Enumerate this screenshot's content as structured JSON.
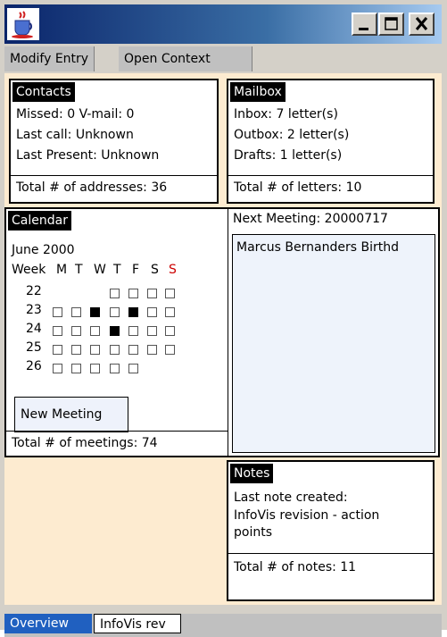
{
  "window": {
    "icon": "java-cup-icon",
    "controls": [
      "minimize",
      "maximize",
      "close"
    ]
  },
  "menu": {
    "items": [
      "Modify Entry",
      "Open Context"
    ]
  },
  "contacts": {
    "title": "Contacts",
    "missed": "Missed: 0 V-mail: 0",
    "last_call": "Last call: Unknown",
    "last_present": "Last Present: Unknown",
    "total": "Total # of addresses: 36"
  },
  "mailbox": {
    "title": "Mailbox",
    "inbox": "Inbox: 7 letter(s)",
    "outbox": "Outbox: 2 letter(s)",
    "drafts": "Drafts: 1 letter(s)",
    "total": "Total # of letters: 10"
  },
  "calendar": {
    "title": "Calendar",
    "month": "June 2000",
    "header": {
      "week": "Week",
      "days": [
        "M",
        "T",
        "W",
        "T",
        "F",
        "S",
        "S"
      ],
      "sunday_color": "#cc0000"
    },
    "weeks": [
      {
        "num": "22",
        "days": [
          null,
          null,
          null,
          "free",
          "free",
          "free",
          "free"
        ]
      },
      {
        "num": "23",
        "days": [
          "free",
          "free",
          "busy",
          "free",
          "busy",
          "free",
          "free"
        ]
      },
      {
        "num": "24",
        "days": [
          "free",
          "free",
          "free",
          "busy",
          "free",
          "free",
          "free"
        ]
      },
      {
        "num": "25",
        "days": [
          "free",
          "free",
          "free",
          "free",
          "free",
          "free",
          "free"
        ]
      },
      {
        "num": "26",
        "days": [
          "free",
          "free",
          "free",
          "free",
          "free",
          null,
          null
        ]
      }
    ],
    "new_meeting_label": "New Meeting",
    "total": "Total # of meetings: 74"
  },
  "next_meeting": {
    "label": "Next Meeting: 20000717",
    "entries": [
      "Marcus Bernanders Birthd"
    ]
  },
  "notes": {
    "title": "Notes",
    "last_created_label": "Last note created:",
    "last_note_line1": "InfoVis revision - action",
    "last_note_line2": "points",
    "total": "Total # of notes: 11"
  },
  "tabs": {
    "overview": "Overview",
    "second": "InfoVis rev"
  },
  "colors": {
    "titlebar_start": "#0a246a",
    "content_bg": "#fdebd0",
    "tab_active": "#2060c0",
    "list_bg": "#eef3fb"
  }
}
